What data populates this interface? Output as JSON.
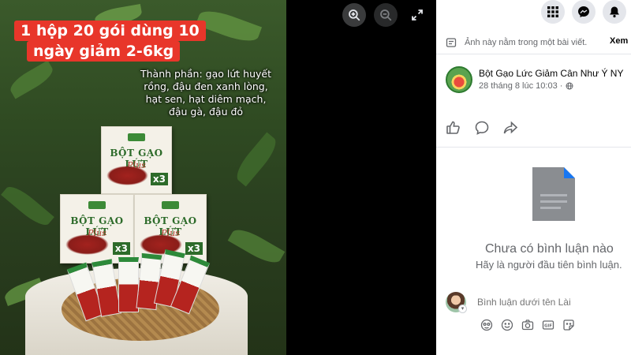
{
  "photo": {
    "caption_line1": "1 hộp 20 gói dùng 10",
    "caption_line2": "ngày giảm 2-6kg",
    "ingredients": "Thành phần: gạo lứt huyết rồng, đậu đen xanh lòng, hạt sen, hạt diêm mạch, đậu gà, đậu đỏ",
    "box_brand": "BỘT GẠO LỨT",
    "box_plus": "Plus",
    "box_multiplier": "x3",
    "sachet_label": "BỘT GẠO LỨT"
  },
  "viewer": {
    "zoom_in_icon": "zoom-in-icon",
    "zoom_out_icon": "zoom-out-icon",
    "fullscreen_icon": "fullscreen-icon"
  },
  "topbar": {
    "icons": [
      "menu-grid-icon",
      "messenger-icon",
      "bell-icon"
    ]
  },
  "post": {
    "note": "Ảnh này nằm trong một bài viết.",
    "see_more": "Xem b",
    "author": "Bột Gạo Lức Giảm Cân Như Ý NY",
    "time": "28 tháng 8 lúc 10:03 ·",
    "actions": [
      "like-icon",
      "comment-icon",
      "share-icon"
    ]
  },
  "comments": {
    "empty_title": "Chưa có bình luận nào",
    "empty_sub": "Hãy là người đầu tiên bình luận.",
    "input_placeholder": "Bình luận dưới tên Lài",
    "tools": [
      "avatar-sticker-icon",
      "emoji-icon",
      "camera-icon",
      "gif-icon",
      "sticker-icon"
    ]
  },
  "colors": {
    "caption_red": "#e8362a",
    "brand_green": "#2d6b2a",
    "panel_bg": "#ffffff",
    "muted_text": "#65676b",
    "doc_blue": "#1877f2"
  }
}
